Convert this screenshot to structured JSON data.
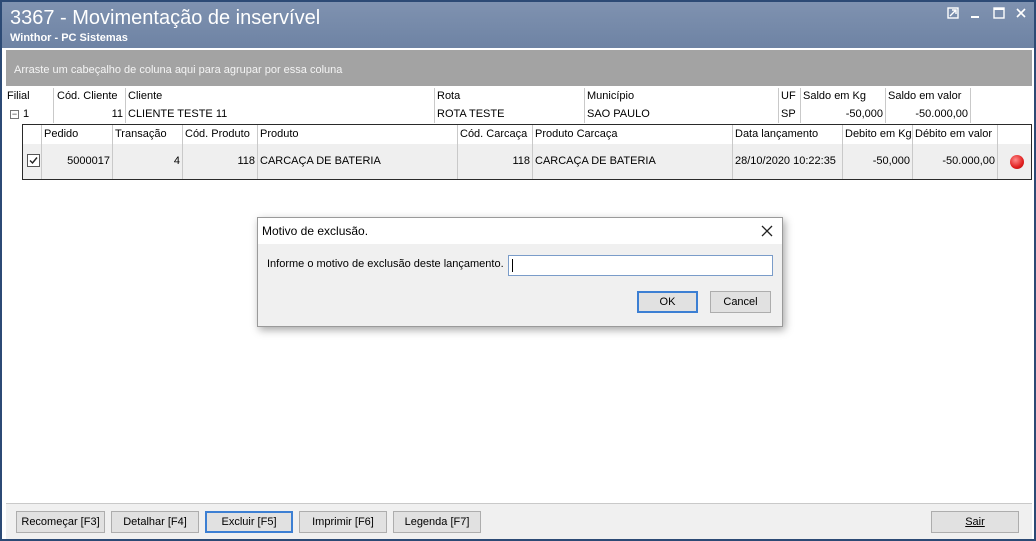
{
  "window": {
    "title": "3367 - Movimentação de inservível",
    "subtitle": "Winthor - PC Sistemas"
  },
  "groupbar": {
    "hint": "Arraste um cabeçalho de coluna aqui para agrupar por essa coluna"
  },
  "master": {
    "headers": {
      "filial": "Filial",
      "cod_cliente": "Cód. Cliente",
      "cliente": "Cliente",
      "rota": "Rota",
      "municipio": "Município",
      "uf": "UF",
      "saldo_kg": "Saldo em Kg",
      "saldo_valor": "Saldo em valor"
    },
    "row": {
      "filial": "1",
      "cod_cliente": "11",
      "cliente": "CLIENTE TESTE 11",
      "rota": "ROTA TESTE",
      "municipio": "SAO PAULO",
      "uf": "SP",
      "saldo_kg": "-50,000",
      "saldo_valor": "-50.000,00"
    }
  },
  "detail": {
    "headers": {
      "pedido": "Pedido",
      "transacao": "Transação",
      "cod_produto": "Cód. Produto",
      "produto": "Produto",
      "cod_carcaca": "Cód. Carcaça",
      "produto_carcaca": "Produto Carcaça",
      "data_lancamento": "Data lançamento",
      "debito_kg": "Debito em Kg",
      "debito_valor": "Débito em valor"
    },
    "row": {
      "checked": true,
      "pedido": "5000017",
      "transacao": "4",
      "cod_produto": "118",
      "produto": "CARCAÇA DE BATERIA",
      "cod_carcaca": "118",
      "produto_carcaca": "CARCAÇA DE BATERIA",
      "data_lancamento": "28/10/2020 10:22:35",
      "debito_kg": "-50,000",
      "debito_valor": "-50.000,00",
      "status_color": "#e01f1f"
    }
  },
  "dialog": {
    "title": "Motivo de exclusão.",
    "label": "Informe o motivo de exclusão deste lançamento.",
    "input_value": "",
    "ok_label": "OK",
    "cancel_label": "Cancel"
  },
  "footer": {
    "recomecar": "Recomeçar [F3]",
    "detalhar": "Detalhar [F4]",
    "excluir": "Excluir [F5]",
    "imprimir": "Imprimir [F6]",
    "legenda": "Legenda [F7]",
    "sair": "Sair"
  },
  "colors": {
    "titlebar": "#7589a9",
    "groupbar": "#a3a3a3",
    "accent": "#3c7fd3"
  }
}
